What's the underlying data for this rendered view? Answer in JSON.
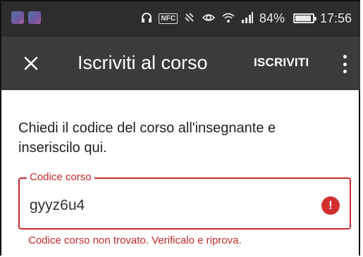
{
  "status_bar": {
    "battery": "84%",
    "battery_level": 0.84,
    "time": "17:56",
    "nfc_label": "NFC",
    "icons": [
      "headphones-icon",
      "nfc-icon",
      "vibrate-off-icon",
      "eye-icon",
      "wifi-icon",
      "signal-icon",
      "battery-icon"
    ]
  },
  "app_bar": {
    "close_icon": "close-icon",
    "title": "Iscriviti al corso",
    "action_label": "ISCRIVITI",
    "more_icon": "more-vert-icon"
  },
  "content": {
    "instructions": "Chiedi il codice del corso all'insegnante e inseriscilo qui.",
    "field": {
      "label": "Codice corso",
      "value": "gyyz6u4",
      "error_icon": "!",
      "error_message": "Codice corso non trovato. Verificalo e riprova."
    }
  },
  "colors": {
    "status_bar_bg": "#2d2d2d",
    "app_bar_bg": "#3b3b3b",
    "error": "#c62828"
  }
}
